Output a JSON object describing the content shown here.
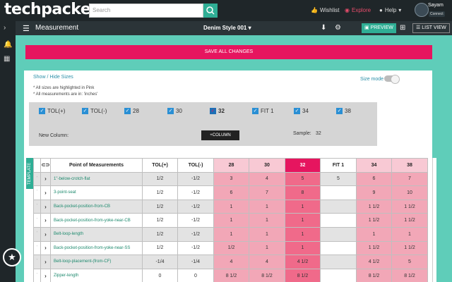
{
  "topbar": {
    "logo": "techpacker",
    "search_placeholder": "Search",
    "wishlist": "Wishlist",
    "explore": "Explore",
    "help": "Help",
    "user": "Sayam",
    "connect": "Connect"
  },
  "subbar": {
    "title": "Measurement",
    "style": "Denim Style 001",
    "preview": "PREVIEW",
    "listview": "LIST VIEW"
  },
  "save_all": "SAVE ALL CHANGES",
  "show_hide": "Show / Hide Sizes",
  "notes": [
    "* All sizes are highlighted in Pink",
    "* All measurements are in: 'inches'"
  ],
  "size_mode": "Size mode",
  "checkboxes": [
    "TOL(+)",
    "TOL(-)",
    "28",
    "30",
    "32",
    "FIT 1",
    "34",
    "38"
  ],
  "new_column_label": "New Column:",
  "add_column_btn": "+COLUMN",
  "sample_label": "Sample:",
  "sample_value": "32",
  "template_tab": "TEMPLATE",
  "table": {
    "headers": [
      "Point of Measurements",
      "TOL(+)",
      "TOL(-)",
      "28",
      "30",
      "32",
      "FIT 1",
      "34",
      "38"
    ],
    "rows": [
      [
        "1\"-below-crotch-flat",
        "1/2",
        "-1/2",
        "3",
        "4",
        "5",
        "5",
        "6",
        "7"
      ],
      [
        "3-point-seat",
        "1/2",
        "-1/2",
        "6",
        "7",
        "8",
        "",
        "9",
        "10"
      ],
      [
        "Back-pocket-position-from-CB",
        "1/2",
        "-1/2",
        "1",
        "1",
        "1",
        "",
        "1 1/2",
        "1 1/2"
      ],
      [
        "Back-pocket-position-from-yoke-near-CB",
        "1/2",
        "-1/2",
        "1",
        "1",
        "1",
        "",
        "1 1/2",
        "1 1/2"
      ],
      [
        "Belt-loop-length",
        "1/2",
        "-1/2",
        "1",
        "1",
        "1",
        "",
        "1",
        "1"
      ],
      [
        "Back-pocket-position-from-yoke-near-SS",
        "1/2",
        "-1/2",
        "1/2",
        "1",
        "1",
        "",
        "1 1/2",
        "1 1/2"
      ],
      [
        "Belt-loop-placement-(from-CF)",
        "-1/4",
        "-1/4",
        "4",
        "4",
        "4 1/2",
        "",
        "4 1/2",
        "5"
      ],
      [
        "Zipper-length",
        "0",
        "0",
        "8 1/2",
        "8 1/2",
        "8 1/2",
        "",
        "8 1/2",
        "8 1/2"
      ]
    ]
  }
}
